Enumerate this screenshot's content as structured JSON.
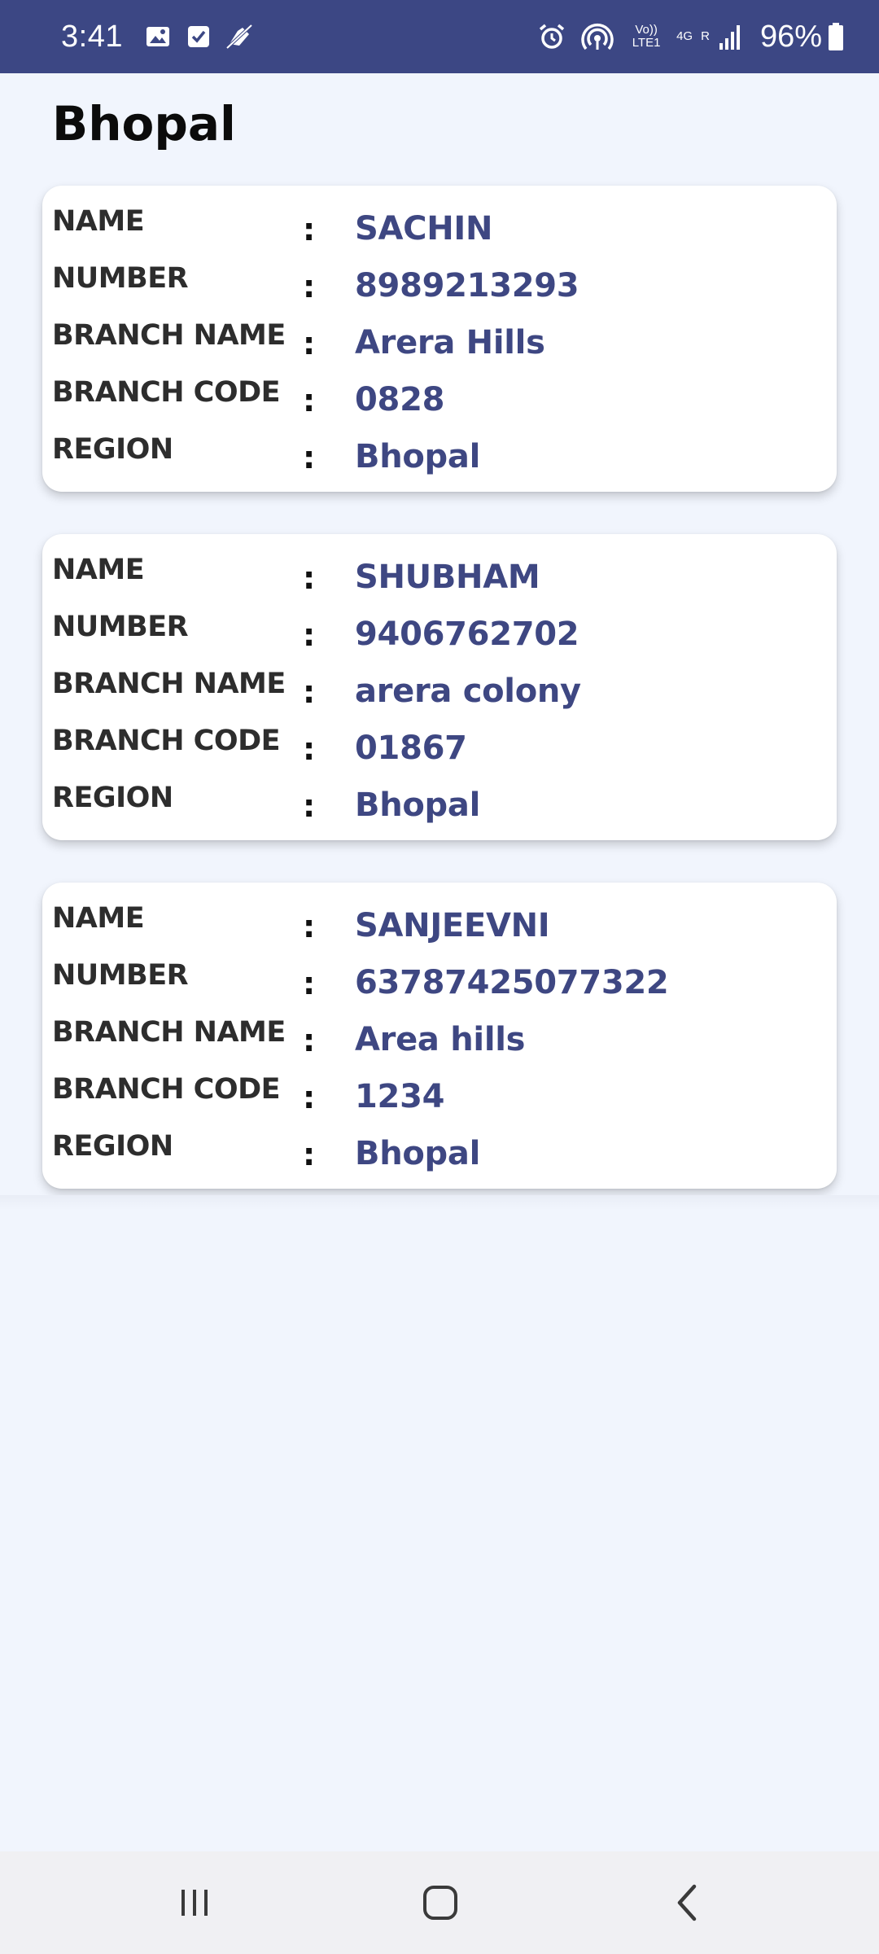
{
  "status_bar": {
    "time": "3:41",
    "left_icons": [
      "image-icon",
      "checkbox-icon",
      "no-flash-icon"
    ],
    "right_icons": [
      "alarm-icon",
      "hotspot-icon"
    ],
    "volte": "Vo)) LTE1",
    "network": "4G",
    "roaming": "R",
    "battery": "96%"
  },
  "page": {
    "title": "Bhopal"
  },
  "labels": {
    "name": "NAME",
    "number": "NUMBER",
    "branch_name": "BRANCH NAME",
    "branch_code": "BRANCH CODE",
    "region": "REGION",
    "separator": ":"
  },
  "records": [
    {
      "name": "SACHIN",
      "number": "8989213293",
      "branch_name": "Arera Hills",
      "branch_code": "0828",
      "region": "Bhopal"
    },
    {
      "name": "SHUBHAM",
      "number": "9406762702",
      "branch_name": "arera colony",
      "branch_code": "01867",
      "region": "Bhopal"
    },
    {
      "name": "SANJEEVNI",
      "number": "63787425077322",
      "branch_name": "Area hills",
      "branch_code": "1234",
      "region": "Bhopal"
    }
  ],
  "nav": {
    "buttons": [
      "recent-apps",
      "home",
      "back"
    ]
  },
  "colors": {
    "status_bar": "#3c4784",
    "background": "#f1f5fd",
    "value_text": "#3e4782",
    "label_text": "#2d2d2d"
  }
}
